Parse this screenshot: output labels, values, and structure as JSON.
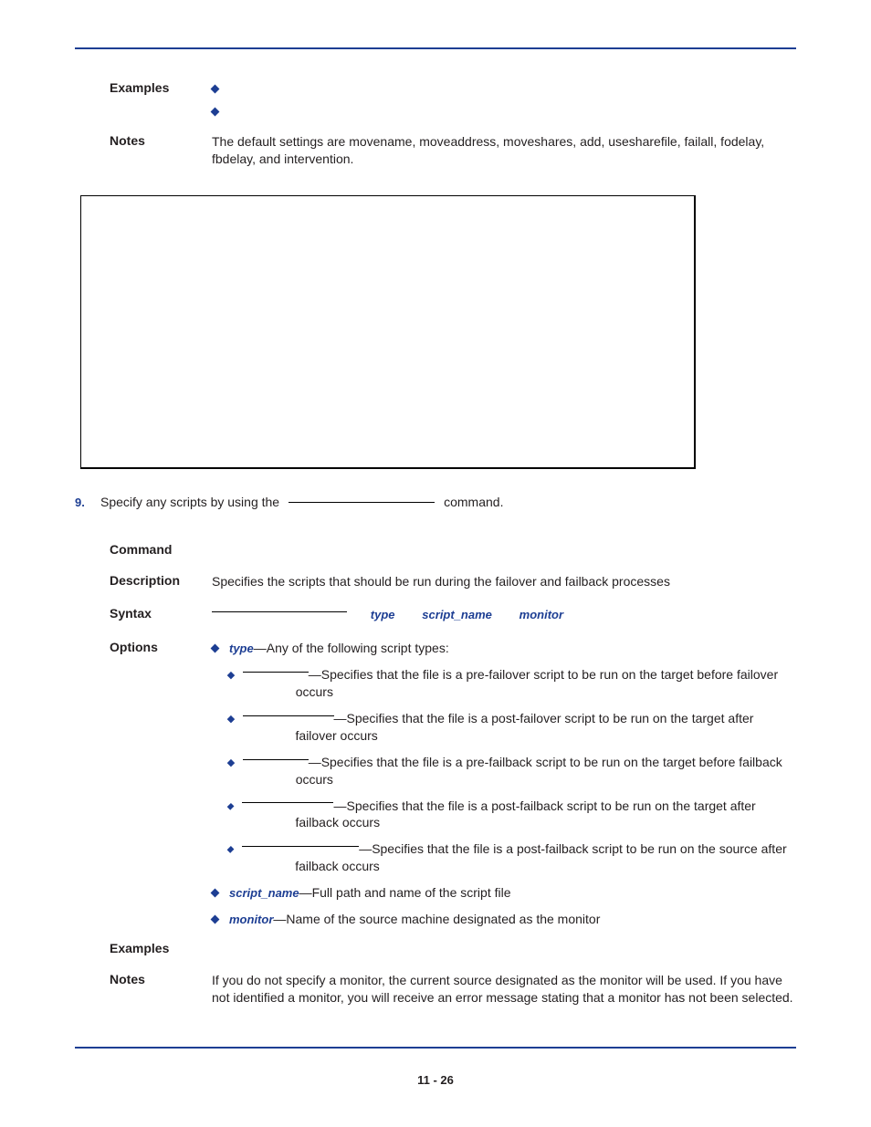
{
  "block1": {
    "examples_label": "Examples",
    "notes_label": "Notes",
    "notes_text": "The default settings are movename, moveaddress, moveshares, add, usesharefile, failall, fodelay, fbdelay, and intervention."
  },
  "step9": {
    "num": "9.",
    "pre": "Specify any scripts by using the",
    "post": "command."
  },
  "block2": {
    "command_label": "Command",
    "description_label": "Description",
    "description_text": "Specifies the scripts that should be run during the failover and failback processes",
    "syntax_label": "Syntax",
    "syntax_p1": "type",
    "syntax_p2": "script_name",
    "syntax_p3": "monitor",
    "options_label": "Options",
    "opt_type_label": "type",
    "opt_type_tail": "—Any of the following script types:",
    "sub1": "—Specifies that the file is a pre-failover script to be run on the target before failover occurs",
    "sub2": "—Specifies that the file is a post-failover script to be run on the target after failover occurs",
    "sub3": "—Specifies that the file is a pre-failback script to be run on the target before failback occurs",
    "sub4": "—Specifies that the file is a post-failback script to be run on the target after failback occurs",
    "sub5": "—Specifies that the file is a post-failback script to be run on the source after failback occurs",
    "opt_script_label": "script_name",
    "opt_script_tail": "—Full path and name of the script file",
    "opt_monitor_label": "monitor",
    "opt_monitor_tail": "—Name of the source machine designated as the monitor",
    "examples_label": "Examples",
    "notes_label": "Notes",
    "notes_text": "If you do not specify a monitor, the current source designated as the monitor will be used. If you have not identified a monitor, you will receive an error message stating that a monitor has not been selected."
  },
  "footer": "11 - 26"
}
